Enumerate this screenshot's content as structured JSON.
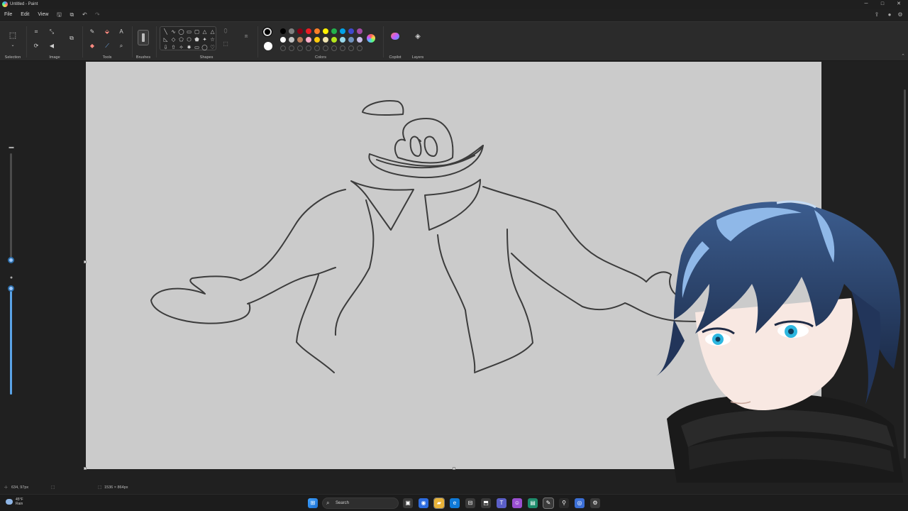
{
  "window": {
    "title": "Untitled - Paint",
    "minimize": "─",
    "maximize": "□",
    "close": "✕"
  },
  "menu": {
    "file": "File",
    "edit": "Edit",
    "view": "View"
  },
  "quick_access": {
    "save": "🖫",
    "history": "⧉",
    "undo": "↶",
    "redo": "↷"
  },
  "top_right": {
    "share": "⇪",
    "account": "●",
    "settings": "⚙"
  },
  "ribbon": {
    "groups": {
      "selection": "Selection",
      "image": "Image",
      "tools": "Tools",
      "brushes": "Brushes",
      "shapes": "Shapes",
      "colors": "Colors",
      "copilot": "Copilot",
      "layers": "Layers"
    },
    "shapes": [
      "╲",
      "∿",
      "◯",
      "▭",
      "▢",
      "△",
      "△",
      "◺",
      "◇",
      "⬠",
      "⬡",
      "⬟",
      "✦",
      "☆",
      "⇩",
      "⇧",
      "✧",
      "✸",
      "▭",
      "◯",
      "♡"
    ],
    "palette_row1": [
      "#000000",
      "#7f7f7f",
      "#880015",
      "#ed1c24",
      "#ff7f27",
      "#fff200",
      "#22b14c",
      "#00a2e8",
      "#3f48cc",
      "#a349a4"
    ],
    "palette_row2": [
      "#ffffff",
      "#c3c3c3",
      "#b97a57",
      "#ffaec9",
      "#ffc90e",
      "#efe4b0",
      "#b5e61d",
      "#99d9ea",
      "#7092be",
      "#c8bfe7"
    ],
    "primary_color": "#000000",
    "secondary_color": "#ffffff",
    "collapse": "⌃"
  },
  "status": {
    "cursor_pos": "634, 97px",
    "selection_icon": "⬚",
    "canvas_size": "1536 × 864px"
  },
  "taskbar": {
    "weather_temp": "45°F",
    "weather_text": "Rain",
    "search_placeholder": "Search",
    "search_icon": "⌕"
  }
}
